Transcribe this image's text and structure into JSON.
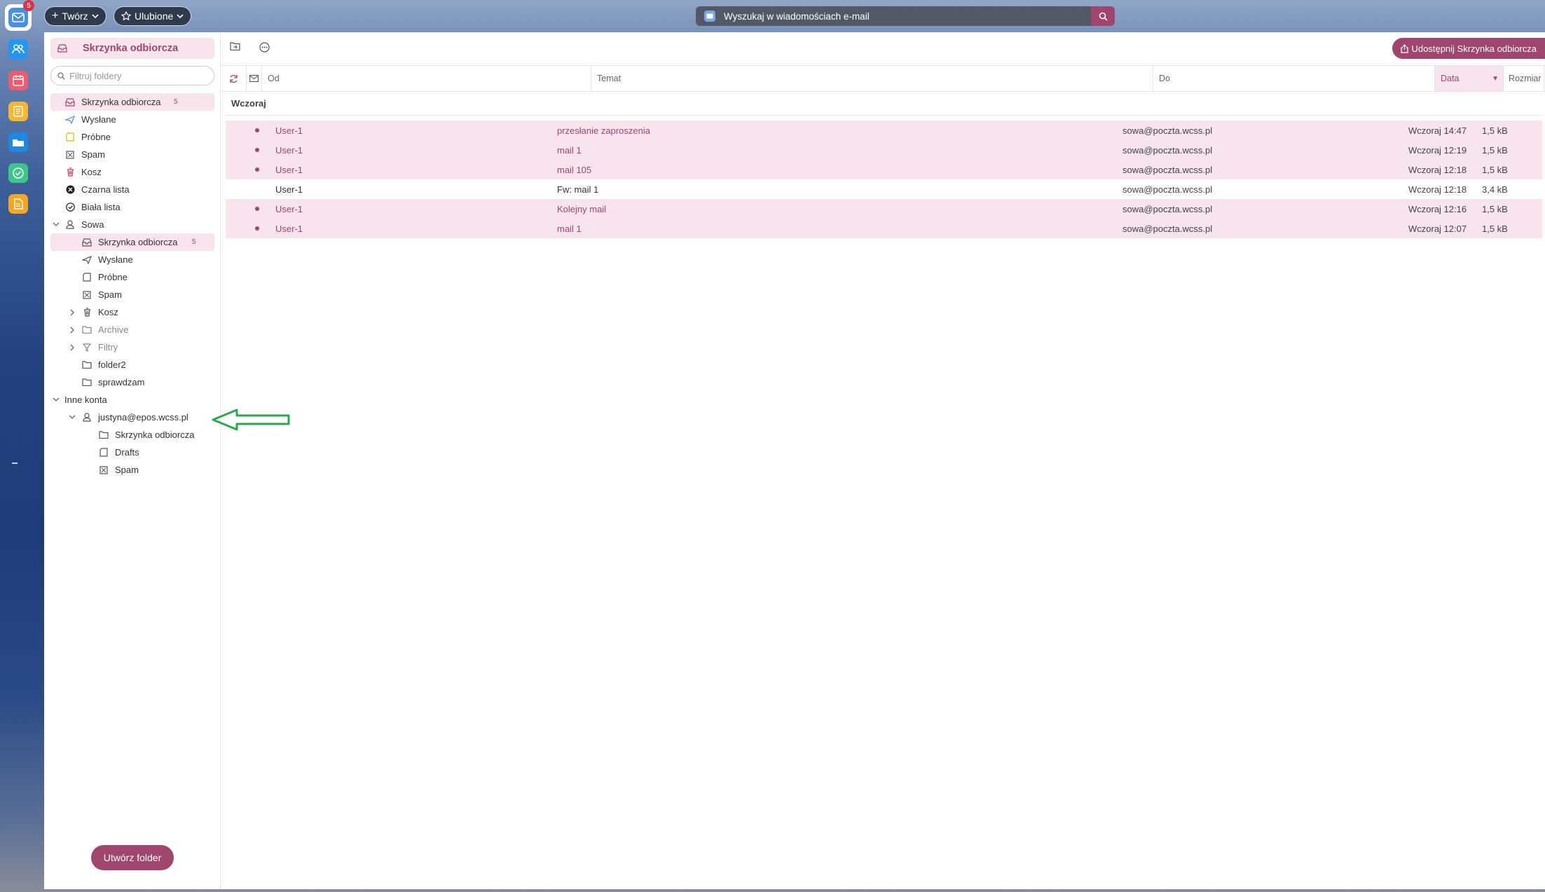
{
  "topbar": {
    "create_label": "Twórz",
    "favorites_label": "Ulubione",
    "search_placeholder": "Wyszukaj w wiadomościach e-mail"
  },
  "dock": {
    "mail_badge": "5",
    "apps": [
      "mail-icon",
      "contacts-icon",
      "calendar-icon",
      "notes-icon",
      "files-icon",
      "tasks-icon",
      "documents-icon"
    ],
    "colors": {
      "mail": "#4a90e2",
      "contacts": "#2196f3",
      "calendar": "#f05a6e",
      "notes": "#f5b731",
      "files": "#1e88e5",
      "tasks": "#3cc68a",
      "documents": "#f5a623"
    }
  },
  "sidebar": {
    "title": "Skrzynka odbiorcza",
    "filter_placeholder": "Filtruj foldery",
    "folders": [
      {
        "label": "Skrzynka odbiorcza",
        "count": "5",
        "icon": "inbox-icon",
        "selected": true
      },
      {
        "label": "Wysłane",
        "icon": "send-icon"
      },
      {
        "label": "Próbne",
        "icon": "draft-icon"
      },
      {
        "label": "Spam",
        "icon": "spam-icon"
      },
      {
        "label": "Kosz",
        "icon": "trash-icon"
      },
      {
        "label": "Czarna lista",
        "icon": "blacklist-icon"
      },
      {
        "label": "Biała lista",
        "icon": "whitelist-icon"
      }
    ],
    "account": "Sowa",
    "account_folders": [
      {
        "label": "Skrzynka odbiorcza",
        "count": "5",
        "icon": "inbox-icon",
        "selected": true
      },
      {
        "label": "Wysłane",
        "icon": "send-icon"
      },
      {
        "label": "Próbne",
        "icon": "draft-icon"
      },
      {
        "label": "Spam",
        "icon": "spam-icon"
      },
      {
        "label": "Kosz",
        "icon": "trash-icon",
        "expandable": true
      },
      {
        "label": "Archive",
        "icon": "folder-icon",
        "expandable": true,
        "grey": true
      },
      {
        "label": "Filtry",
        "icon": "filter-icon",
        "expandable": true,
        "grey": true
      },
      {
        "label": "folder2",
        "icon": "folder-icon"
      },
      {
        "label": "sprawdzam",
        "icon": "folder-icon"
      }
    ],
    "other_accounts_label": "Inne konta",
    "other_account": "justyna@epos.wcss.pl",
    "other_account_folders": [
      {
        "label": "Skrzynka odbiorcza",
        "icon": "folder-icon"
      },
      {
        "label": "Drafts",
        "icon": "draft-icon"
      },
      {
        "label": "Spam",
        "icon": "spam-icon"
      }
    ],
    "create_folder_label": "Utwórz folder"
  },
  "main": {
    "share_label": "Udostępnij Skrzynka odbiorcza",
    "columns": {
      "from": "Od",
      "subject": "Temat",
      "to": "Do",
      "date": "Data",
      "size": "Rozmiar"
    },
    "group_label": "Wczoraj",
    "messages": [
      {
        "from": "User-1",
        "subject": "przesłanie zaproszenia",
        "to": "sowa@poczta.wcss.pl",
        "date": "Wczoraj 14:47",
        "size": "1,5 kB",
        "unread": true
      },
      {
        "from": "User-1",
        "subject": "mail 1",
        "to": "sowa@poczta.wcss.pl",
        "date": "Wczoraj 12:19",
        "size": "1,5 kB",
        "unread": true
      },
      {
        "from": "User-1",
        "subject": "mail 105",
        "to": "sowa@poczta.wcss.pl",
        "date": "Wczoraj 12:18",
        "size": "1,5 kB",
        "unread": true
      },
      {
        "from": "User-1",
        "subject": "Fw: mail 1",
        "to": "sowa@poczta.wcss.pl",
        "date": "Wczoraj 12:18",
        "size": "3,4 kB",
        "unread": false
      },
      {
        "from": "User-1",
        "subject": "Kolejny mail",
        "to": "sowa@poczta.wcss.pl",
        "date": "Wczoraj 12:16",
        "size": "1,5 kB",
        "unread": true
      },
      {
        "from": "User-1",
        "subject": "mail 1",
        "to": "sowa@poczta.wcss.pl",
        "date": "Wczoraj 12:07",
        "size": "1,5 kB",
        "unread": true
      }
    ],
    "accent": "#a0466e",
    "annotation_arrow_color": "#2aa84a"
  }
}
